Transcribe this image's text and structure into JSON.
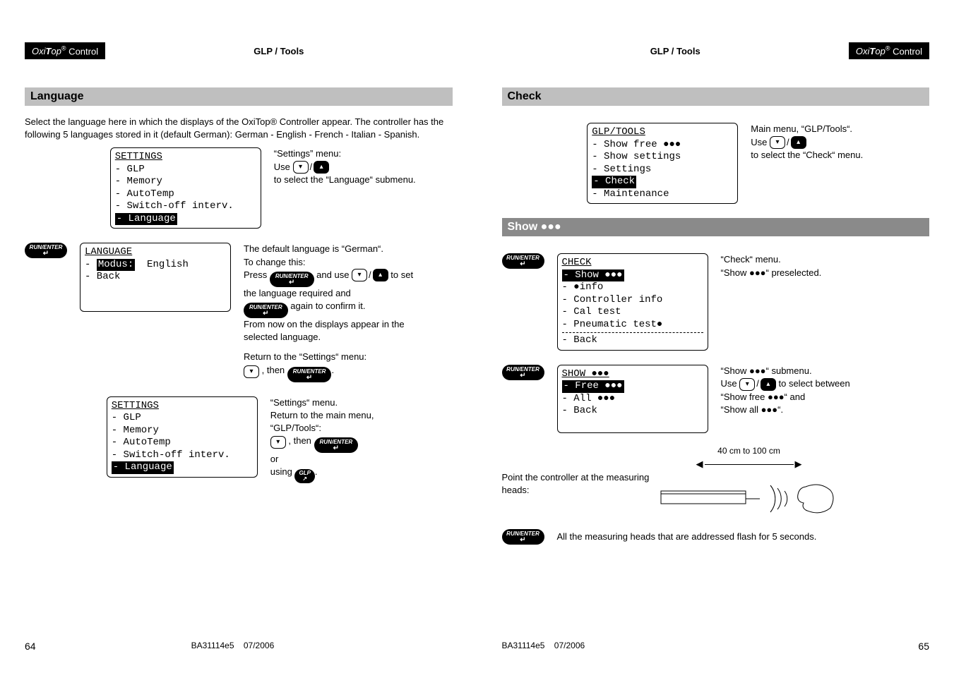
{
  "brand": {
    "name_html": "OxiTop®",
    "name_plain": "OxiTop",
    "suffix": " Control"
  },
  "section_title": "GLP / Tools",
  "left_page": {
    "heading": "Language",
    "intro": "Select the language here in which the displays of the OxiTop® Controller appear. The controller has the following 5 languages stored in it (default German): German - English - French - Italian - Spanish.",
    "lcd1": {
      "title": "SETTINGS",
      "lines": [
        "- GLP",
        "- Memory",
        "- AutoTemp",
        "- Switch-off interv."
      ],
      "selected": "- Language"
    },
    "note1": {
      "a": "“Settings” menu:",
      "b": "Use",
      "c": "to select the “Language“ submenu."
    },
    "lcd2": {
      "title": "LANGUAGE",
      "sel_label": "Modus:",
      "sel_value": "English",
      "back": "- Back"
    },
    "note2": {
      "a": "The default language is “German“.",
      "b": "To change this:",
      "c": "Press",
      "d": "and use",
      "e": "to set the language required and",
      "f": "again to confirm it.",
      "g": "From now on the displays appear in the selected language.",
      "h": "Return to the “Settings“ menu:",
      "i": ", then"
    },
    "lcd3": {
      "title": "SETTINGS",
      "lines": [
        "- GLP",
        "- Memory",
        "- AutoTemp",
        "- Switch-off interv."
      ],
      "selected": "- Language"
    },
    "note3": {
      "a": "“Settings“ menu.",
      "b": "Return to the main menu, “GLP/Tools“:",
      "c": ", then",
      "d": "or",
      "e": "using"
    },
    "button_labels": {
      "run_enter": "RUN/ENTER",
      "glp": "GLP"
    },
    "footer": {
      "page": "64",
      "doc": "BA31114e5",
      "date": "07/2006"
    }
  },
  "right_page": {
    "heading1": "Check",
    "lcd1": {
      "title": "GLP/TOOLS",
      "lines_pre": "- Show free ",
      "bullets3": "●●●",
      "lines": [
        "- Show settings",
        "- Settings"
      ],
      "selected": "- Check",
      "after": "- Maintenance"
    },
    "note1": {
      "a": "Main menu, “GLP/Tools“.",
      "b": "Use",
      "c": "to select the “Check“ menu."
    },
    "heading2_pre": "Show ",
    "lcd2": {
      "title": "CHECK",
      "sel": "- Show ●●●",
      "lines": [
        "- ●info",
        "- Controller info",
        "- Cal test",
        "- Pneumatic test●"
      ],
      "back": "- Back"
    },
    "note2": {
      "a": "“Check“ menu.",
      "b_pre": "“Show ",
      "b_post": "“ preselected."
    },
    "lcd3": {
      "title": "SHOW ●●●",
      "sel": "- Free ●●●",
      "lines": [
        "- All ●●●",
        "- Back"
      ]
    },
    "note3": {
      "a_pre": "“Show ",
      "a_post": "“ submenu.",
      "b": "Use",
      "c": "to select between",
      "d_pre": "“Show free ",
      "d_post": "“ and",
      "e_pre": "“Show all ",
      "e_post": "“."
    },
    "point_text": "Point the controller at the measuring heads:",
    "distance": "40 cm to 100 cm",
    "flash_text": "All the measuring heads that are addressed flash for 5 seconds.",
    "button_labels": {
      "run_enter": "RUN/ENTER"
    },
    "footer": {
      "page": "65",
      "doc": "BA31114e5",
      "date": "07/2006"
    }
  }
}
